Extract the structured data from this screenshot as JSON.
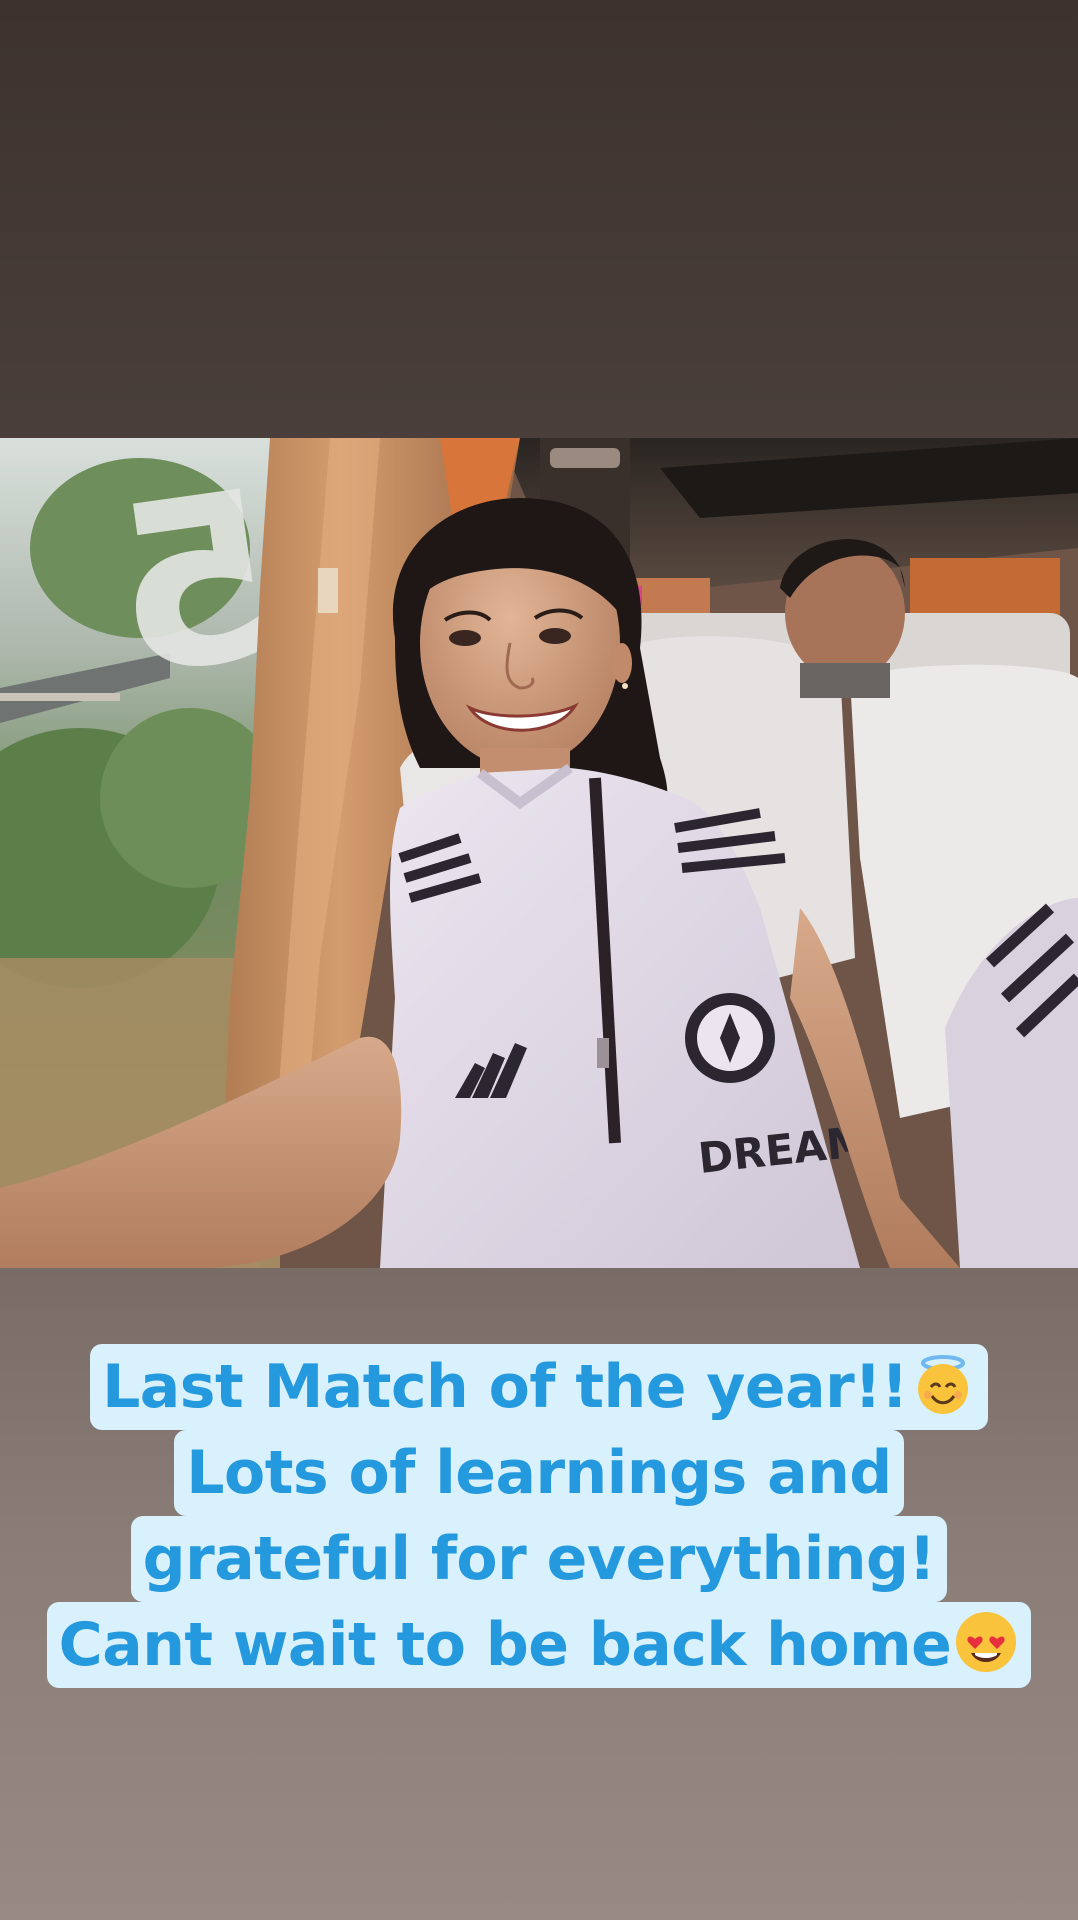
{
  "caption": {
    "lines": [
      "Last Match of the year!!",
      "Lots of learnings and",
      "grateful for everything!",
      "Cant wait to be back home"
    ],
    "line1_emoji": "smiling-face-with-halo-emoji",
    "line4_emoji": "smiling-face-with-heart-eyes-emoji"
  },
  "photo": {
    "jersey_text": "DREAM",
    "window_sticker": "5"
  },
  "colors": {
    "caption_text": "#2599de",
    "caption_background": "#d8f1fc",
    "curtain": "#c98a5c",
    "jersey": "#e4dde9"
  }
}
